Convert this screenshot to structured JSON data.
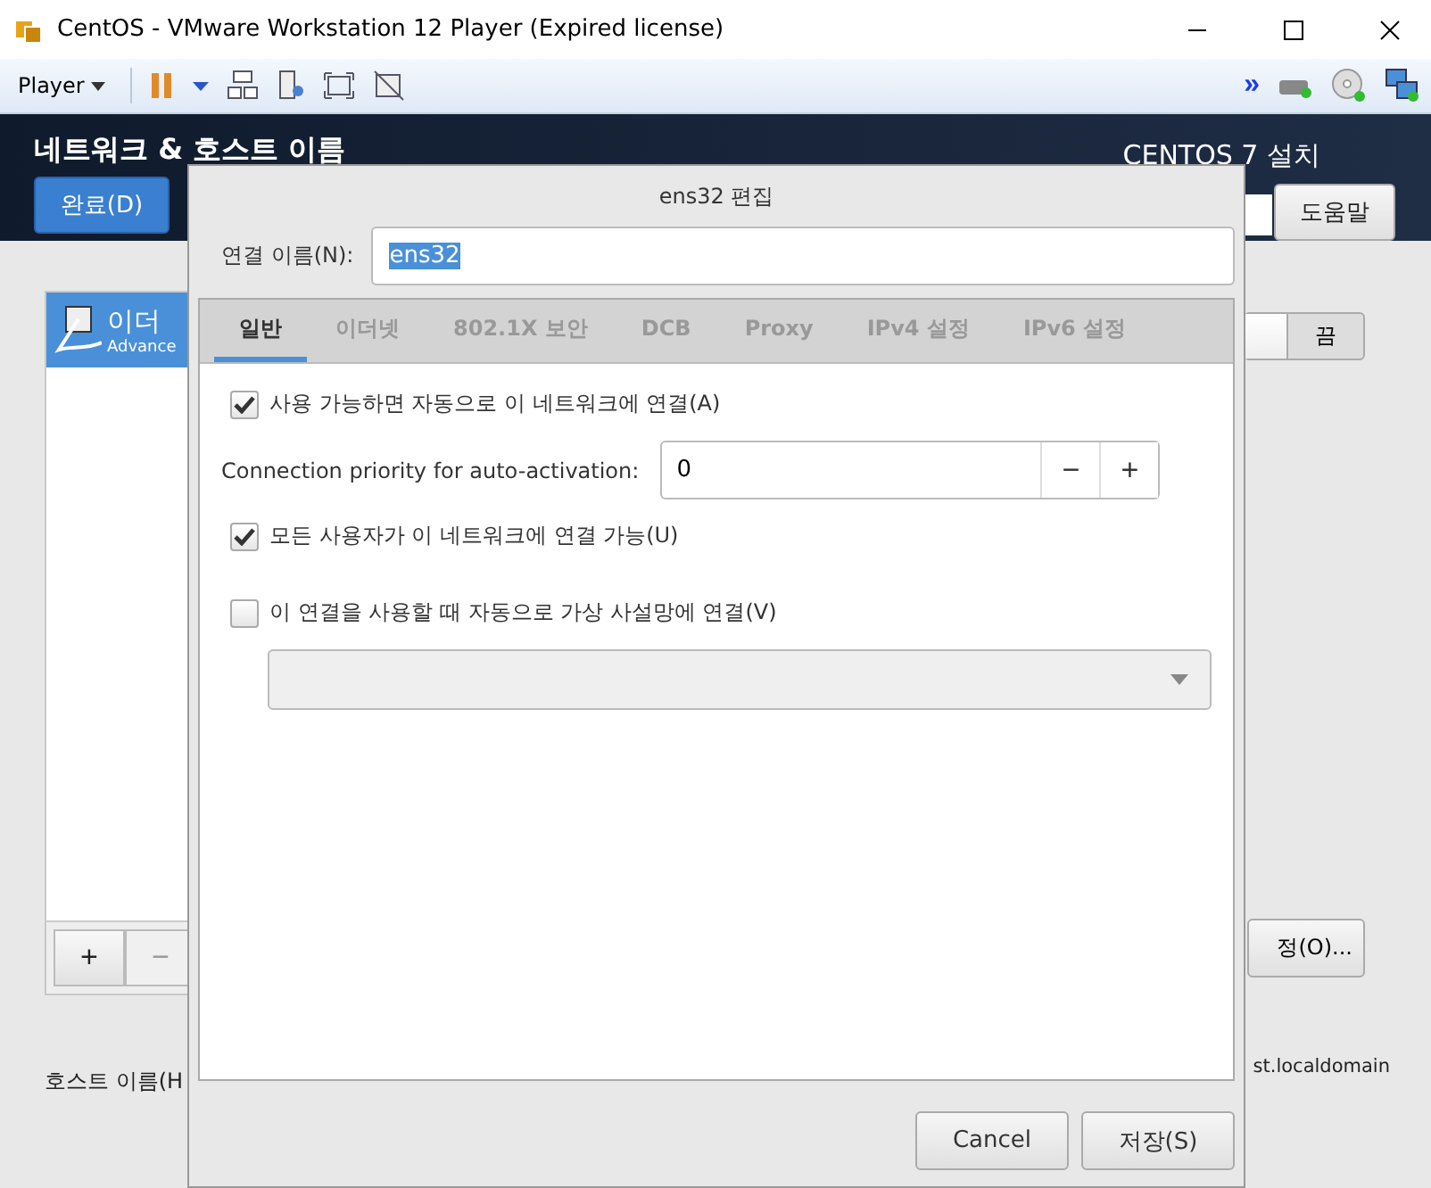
{
  "window": {
    "title": "CentOS - VMware Workstation 12 Player (Expired license)"
  },
  "toolbar": {
    "player_menu": "Player",
    "overflow": "»"
  },
  "installer": {
    "title": "네트워크 & 호스트 이름",
    "done_button": "완료(D)",
    "product": "CENTOS 7 설치",
    "help_button": "도움말",
    "devices": [
      {
        "name": "이더",
        "detail": "Advance",
        "selected": true
      }
    ],
    "switch": {
      "label": "끔",
      "on": false
    },
    "add_button": "+",
    "remove_button": "−",
    "settings_button": "정(O)...",
    "hostname_label": "호스트 이름(H",
    "current_hostname": "st.localdomain"
  },
  "dialog": {
    "title": "ens32 편집",
    "name_label": "연결 이름(N):",
    "name_value": "ens32",
    "tabs": [
      {
        "label": "일반",
        "selected": true
      },
      {
        "label": "이더넷",
        "selected": false
      },
      {
        "label": "802.1X 보안",
        "selected": false
      },
      {
        "label": "DCB",
        "selected": false
      },
      {
        "label": "Proxy",
        "selected": false
      },
      {
        "label": "IPv4 설정",
        "selected": false
      },
      {
        "label": "IPv6 설정",
        "selected": false
      }
    ],
    "options": [
      {
        "kind": "checkbox",
        "label": "사용 가능하면 자동으로 이 네트워크에 연결(A)",
        "checked": true
      },
      {
        "kind": "spin",
        "label": "Connection priority for auto-activation:",
        "value": "0",
        "decrement": "−",
        "increment": "+"
      },
      {
        "kind": "checkbox",
        "label": "모든 사용자가 이 네트워크에 연결 가능(U)",
        "checked": true
      },
      {
        "kind": "checkbox",
        "label": "이 연결을 사용할 때 자동으로 가상 사설망에 연결(V)",
        "checked": false
      },
      {
        "kind": "select"
      }
    ],
    "buttons": [
      "Cancel",
      "저장(S)"
    ]
  }
}
